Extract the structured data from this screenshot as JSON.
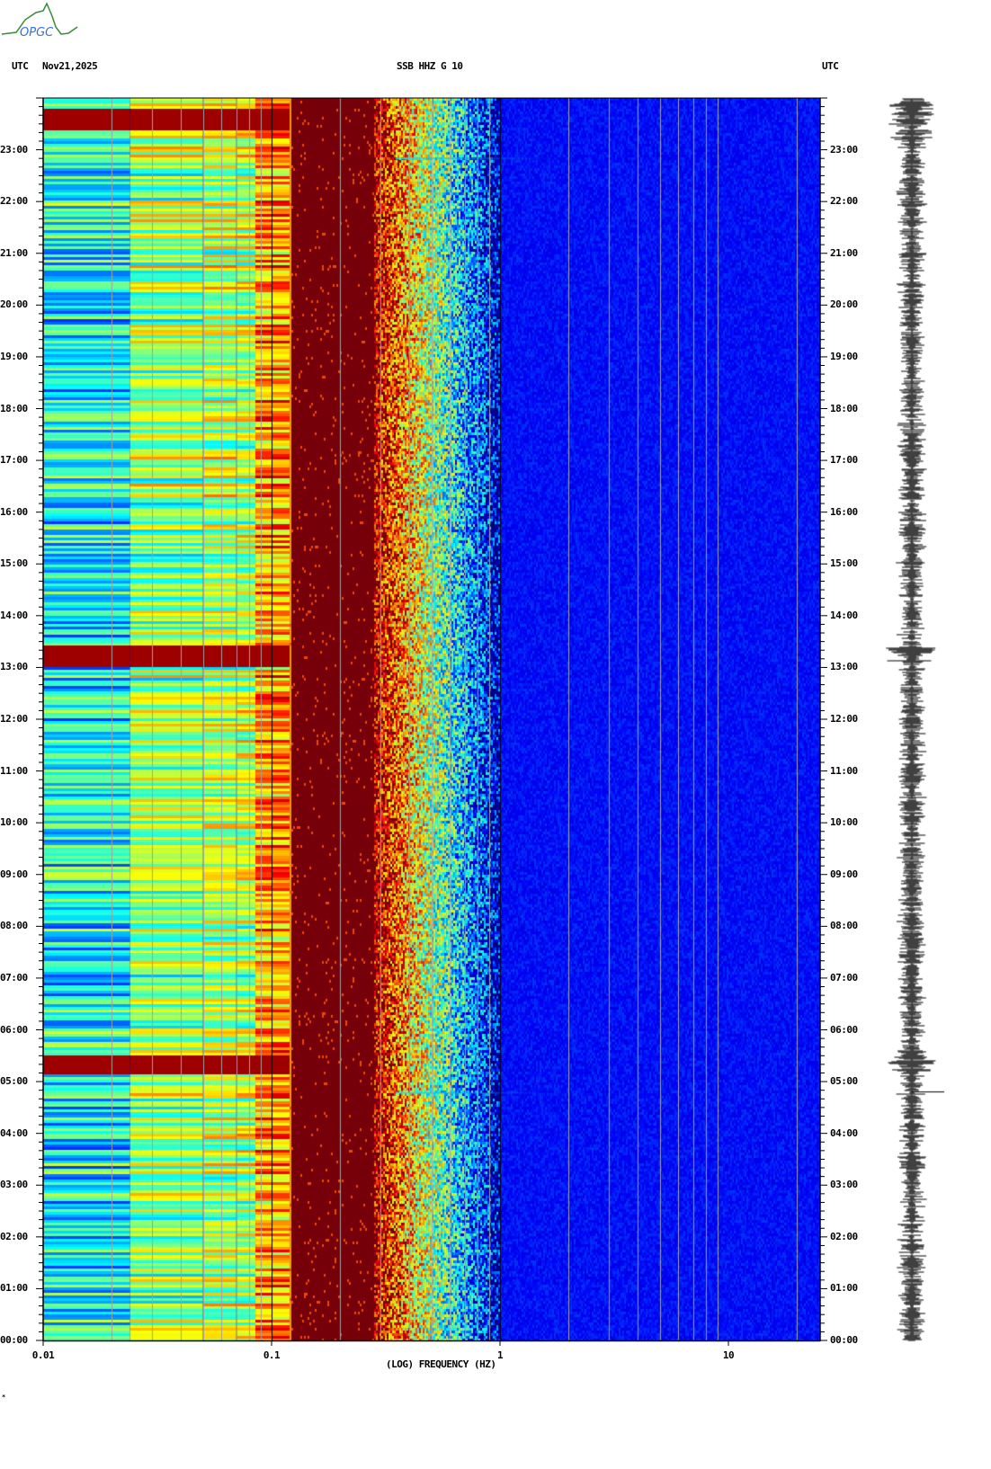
{
  "header": {
    "logo_text": "OPGC",
    "left_label": "UTC",
    "date": "Nov21,2025",
    "station": "SSB HHZ G 10",
    "right_label": "UTC"
  },
  "footer_mark": "*",
  "chart_data": {
    "type": "heatmap",
    "title": "SSB HHZ G 10",
    "date": "Nov21,2025",
    "xlabel": "(LOG) FREQUENCY (HZ)",
    "xscale": "log",
    "xlim": [
      0.01,
      25
    ],
    "x_ticks": [
      "0.01",
      "0.1",
      "1",
      "10"
    ],
    "x_tick_values": [
      0.01,
      0.1,
      1,
      10
    ],
    "ylabel": "UTC",
    "ylim_hours": [
      0,
      24
    ],
    "y_ticks": [
      "00:00",
      "01:00",
      "02:00",
      "03:00",
      "04:00",
      "05:00",
      "06:00",
      "07:00",
      "08:00",
      "09:00",
      "10:00",
      "11:00",
      "12:00",
      "13:00",
      "14:00",
      "15:00",
      "16:00",
      "17:00",
      "18:00",
      "19:00",
      "20:00",
      "21:00",
      "22:00",
      "23:00"
    ],
    "colormap": "jet",
    "band_levels": [
      {
        "fmin": 0.01,
        "fmax": 0.024,
        "level": 0.38
      },
      {
        "fmin": 0.024,
        "fmax": 0.05,
        "level": 0.52
      },
      {
        "fmin": 0.05,
        "fmax": 0.085,
        "level": 0.55
      },
      {
        "fmin": 0.085,
        "fmax": 0.12,
        "level": 0.72
      },
      {
        "fmin": 0.12,
        "fmax": 0.28,
        "level": 1.0
      },
      {
        "fmin": 0.28,
        "fmax": 0.45,
        "level": 0.85
      },
      {
        "fmin": 0.45,
        "fmax": 0.9,
        "level": 0.45
      },
      {
        "fmin": 0.9,
        "fmax": 25,
        "level": 0.1
      }
    ],
    "events_hours": [
      5.35,
      13.25,
      23.6
    ],
    "transient_lines_hours": [
      4.8,
      22.85
    ],
    "colors": {
      "background": "#ffffff",
      "grid": "#a0a0a0",
      "trace": "#000000"
    }
  }
}
